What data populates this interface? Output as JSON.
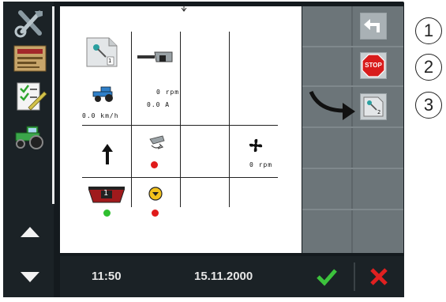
{
  "bottom_bar": {
    "time": "11:50",
    "date": "15.11.2000"
  },
  "main": {
    "cell_rpm_top": "0 rpm",
    "cell_amp": "0.0 A",
    "cell_speed": "0.0 km/h",
    "cell_fan_rpm": "0 rpm",
    "cell_page_number": "1",
    "cell_tank_number": "1"
  },
  "softkeys": {
    "page_number": "2",
    "stop_label": "STOP"
  },
  "callouts": [
    "1",
    "2",
    "3"
  ],
  "colors": {
    "status_red": "#e01b1b",
    "status_green": "#2fbf2f",
    "confirm_green": "#3cc23c",
    "cancel_red": "#e02020",
    "stop_red": "#d81c1c"
  },
  "icons": [
    "tools-icon",
    "machine-card-icon",
    "checklist-icon",
    "tractor-icon",
    "arrow-up-icon",
    "arrow-down-icon",
    "return-icon",
    "stop-icon",
    "page-switch-icon",
    "confirm-icon",
    "cancel-icon",
    "fan-icon",
    "spreader-icon",
    "tank-icon"
  ]
}
